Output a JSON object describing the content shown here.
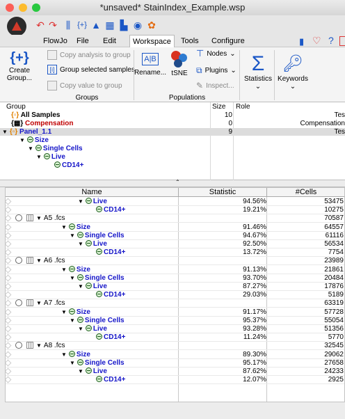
{
  "window": {
    "title": "*unsaved* StainIndex_Example.wsp"
  },
  "menu": {
    "items": [
      "FlowJo",
      "File",
      "Edit",
      "Workspace",
      "Tools",
      "Configure"
    ],
    "active": "Workspace"
  },
  "ribbon": {
    "create_group": "Create\nGroup...",
    "copy_analysis": "Copy analysis to group",
    "group_selected": "Group selected samples",
    "copy_value": "Copy value to group",
    "groups_label": "Groups",
    "rename": "Rename...",
    "tsne": "tSNE",
    "nodes": "Nodes",
    "plugins": "Plugins",
    "inspect": "Inspect...",
    "populations_label": "Populations",
    "statistics": "Statistics",
    "keywords": "Keywords"
  },
  "group_table": {
    "headers": {
      "group": "Group",
      "size": "Size",
      "role": "Role"
    },
    "rows": [
      {
        "name": "All Samples",
        "size": "10",
        "role": "Tes",
        "color": "#000000"
      },
      {
        "name": "Compensation",
        "size": "0",
        "role": "Compensation",
        "color": "#c00000"
      },
      {
        "name": "Panel_1.1",
        "size": "9",
        "role": "Tes",
        "color": "#1414c8"
      },
      {
        "name": "Size",
        "size": "",
        "role": ""
      },
      {
        "name": "Single Cells",
        "size": "",
        "role": ""
      },
      {
        "name": "Live",
        "size": "",
        "role": ""
      },
      {
        "name": "CD14+",
        "size": "",
        "role": ""
      }
    ]
  },
  "sheet": {
    "headers": {
      "name": "Name",
      "statistic": "Statistic",
      "cells": "#Cells"
    },
    "rows": [
      {
        "name": "Live",
        "stat": "94.56%",
        "cells": "53475",
        "indent": 5
      },
      {
        "name": "CD14+",
        "stat": "19.21%",
        "cells": "10275",
        "indent": 6
      },
      {
        "name": "A5 .fcs",
        "stat": "",
        "cells": "70587",
        "indent": 0
      },
      {
        "name": "Size",
        "stat": "91.46%",
        "cells": "64557",
        "indent": 3
      },
      {
        "name": "Single Cells",
        "stat": "94.67%",
        "cells": "61116",
        "indent": 4
      },
      {
        "name": "Live",
        "stat": "92.50%",
        "cells": "56534",
        "indent": 5
      },
      {
        "name": "CD14+",
        "stat": "13.72%",
        "cells": "7754",
        "indent": 6
      },
      {
        "name": "A6 .fcs",
        "stat": "",
        "cells": "23989",
        "indent": 0
      },
      {
        "name": "Size",
        "stat": "91.13%",
        "cells": "21861",
        "indent": 3
      },
      {
        "name": "Single Cells",
        "stat": "93.70%",
        "cells": "20484",
        "indent": 4
      },
      {
        "name": "Live",
        "stat": "87.27%",
        "cells": "17876",
        "indent": 5
      },
      {
        "name": "CD14+",
        "stat": "29.03%",
        "cells": "5189",
        "indent": 6
      },
      {
        "name": "A7 .fcs",
        "stat": "",
        "cells": "63319",
        "indent": 0
      },
      {
        "name": "Size",
        "stat": "91.17%",
        "cells": "57728",
        "indent": 3
      },
      {
        "name": "Single Cells",
        "stat": "95.37%",
        "cells": "55054",
        "indent": 4
      },
      {
        "name": "Live",
        "stat": "93.28%",
        "cells": "51356",
        "indent": 5
      },
      {
        "name": "CD14+",
        "stat": "11.24%",
        "cells": "5770",
        "indent": 6
      },
      {
        "name": "A8 .fcs",
        "stat": "",
        "cells": "32545",
        "indent": 0
      },
      {
        "name": "Size",
        "stat": "89.30%",
        "cells": "29062",
        "indent": 3
      },
      {
        "name": "Single Cells",
        "stat": "95.17%",
        "cells": "27658",
        "indent": 4
      },
      {
        "name": "Live",
        "stat": "87.62%",
        "cells": "24233",
        "indent": 5
      },
      {
        "name": "CD14+",
        "stat": "12.07%",
        "cells": "2925",
        "indent": 6
      }
    ]
  }
}
